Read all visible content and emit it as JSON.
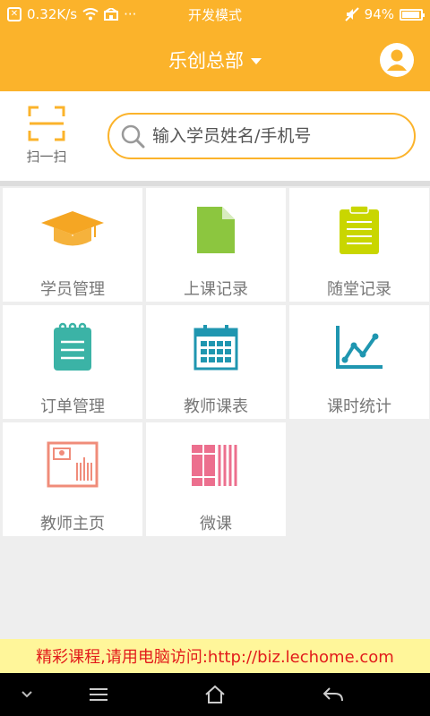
{
  "status_bar": {
    "speed": "0.32K/s",
    "more": "···",
    "mode": "开发模式",
    "battery": "94%",
    "battery_level": 0.94
  },
  "header": {
    "title": "乐创总部"
  },
  "toolbar": {
    "scan_label": "扫一扫",
    "search_placeholder": "输入学员姓名/手机号"
  },
  "menu": {
    "items": [
      {
        "label": "学员管理",
        "icon": "graduation-cap-icon"
      },
      {
        "label": "上课记录",
        "icon": "document-icon"
      },
      {
        "label": "随堂记录",
        "icon": "clipboard-icon"
      },
      {
        "label": "订单管理",
        "icon": "notepad-icon"
      },
      {
        "label": "教师课表",
        "icon": "calendar-icon"
      },
      {
        "label": "课时统计",
        "icon": "line-chart-icon"
      },
      {
        "label": "教师主页",
        "icon": "profile-card-icon"
      },
      {
        "label": "微课",
        "icon": "books-icon"
      }
    ]
  },
  "promo": {
    "text": "精彩课程,请用电脑访问:http://biz.lechome.com"
  },
  "colors": {
    "primary": "#fbb32b",
    "promo_bg": "#fff69a",
    "promo_text": "#e21b1b"
  }
}
